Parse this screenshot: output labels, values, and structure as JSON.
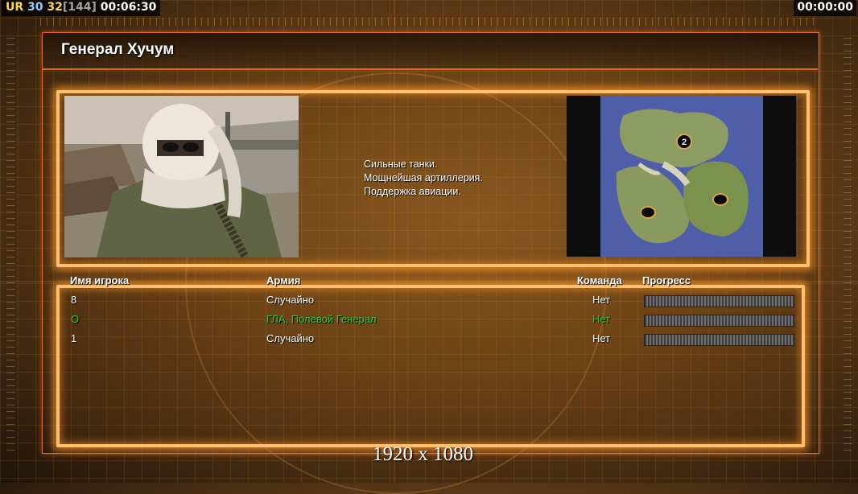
{
  "hud": {
    "tag": "UR",
    "fps": "30",
    "fps2": "32",
    "bracket": "[144]",
    "elapsed": "00:06:30",
    "timer_right": "00:00:00"
  },
  "general": {
    "title": "Генерал Хучум",
    "description": [
      "Сильные танки.",
      "Мощнейшая артиллерия.",
      "Поддержка авиации."
    ]
  },
  "map": {
    "player_marker_label": "2"
  },
  "table": {
    "headers": {
      "name": "Имя игрока",
      "army": "Армия",
      "team": "Команда",
      "progress": "Прогресс"
    },
    "rows": [
      {
        "name": "8",
        "army": "Случайно",
        "team": "Нет",
        "progress": 1.0,
        "color": "#ffffff"
      },
      {
        "name": "O",
        "army": "ГЛА, Полевой Генерал",
        "team": "Нет",
        "progress": 1.0,
        "color": "#3ec23e"
      },
      {
        "name": "1",
        "army": "Случайно",
        "team": "Нет",
        "progress": 1.0,
        "color": "#ffffff"
      }
    ]
  },
  "footer": {
    "resolution": "1920 x 1080"
  },
  "colors": {
    "frame_glow": "#ffc070",
    "local_player": "#3ec23e"
  }
}
